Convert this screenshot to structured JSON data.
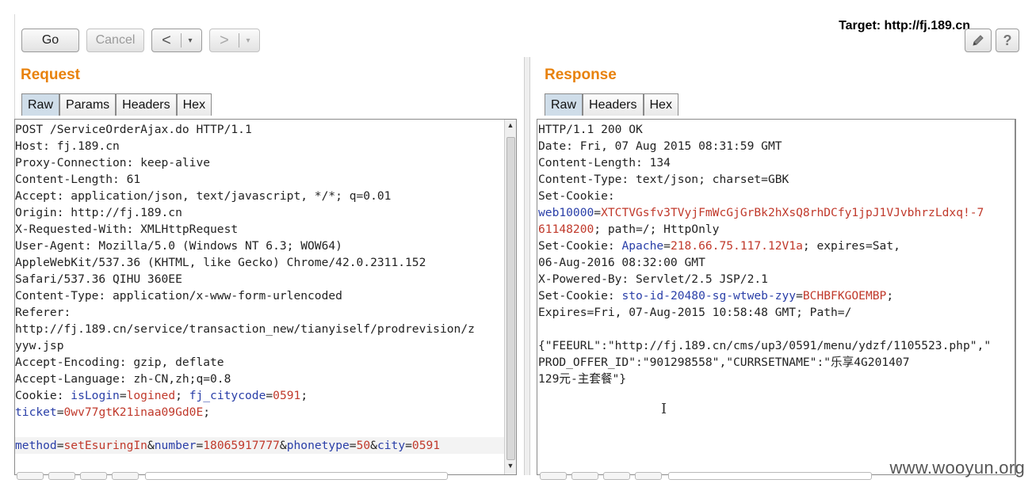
{
  "toolbar": {
    "go_label": "Go",
    "cancel_label": "Cancel",
    "back_symbol": "<",
    "forward_symbol": ">",
    "dropdown_symbol": "▾",
    "target_label": "Target: http://fj.189.cn",
    "edit_icon": "pencil-icon",
    "help_label": "?"
  },
  "request": {
    "title": "Request",
    "tabs": [
      "Raw",
      "Params",
      "Headers",
      "Hex"
    ],
    "active_tab": "Raw",
    "lines": [
      [
        {
          "t": "POST /ServiceOrderAjax.do HTTP/1.1"
        }
      ],
      [
        {
          "t": "Host: fj.189.cn"
        }
      ],
      [
        {
          "t": "Proxy-Connection: keep-alive"
        }
      ],
      [
        {
          "t": "Content-Length: 61"
        }
      ],
      [
        {
          "t": "Accept: application/json, text/javascript, */*; q=0.01"
        }
      ],
      [
        {
          "t": "Origin: http://fj.189.cn"
        }
      ],
      [
        {
          "t": "X-Requested-With: XMLHttpRequest"
        }
      ],
      [
        {
          "t": "User-Agent: Mozilla/5.0 (Windows NT 6.3; WOW64)"
        }
      ],
      [
        {
          "t": "AppleWebKit/537.36 (KHTML, like Gecko) Chrome/42.0.2311.152"
        }
      ],
      [
        {
          "t": "Safari/537.36 QIHU 360EE"
        }
      ],
      [
        {
          "t": "Content-Type: application/x-www-form-urlencoded"
        }
      ],
      [
        {
          "t": "Referer:"
        }
      ],
      [
        {
          "t": "http://fj.189.cn/service/transaction_new/tianyiself/prodrevision/z"
        }
      ],
      [
        {
          "t": "yyw.jsp"
        }
      ],
      [
        {
          "t": "Accept-Encoding: gzip, deflate"
        }
      ],
      [
        {
          "t": "Accept-Language: zh-CN,zh;q=0.8"
        }
      ],
      [
        {
          "t": "Cookie: "
        },
        {
          "t": "isLogin",
          "c": "k"
        },
        {
          "t": "="
        },
        {
          "t": "logined",
          "c": "v"
        },
        {
          "t": "; "
        },
        {
          "t": "fj_citycode",
          "c": "k"
        },
        {
          "t": "="
        },
        {
          "t": "0591",
          "c": "v"
        },
        {
          "t": ";"
        }
      ],
      [
        {
          "t": "ticket",
          "c": "k"
        },
        {
          "t": "="
        },
        {
          "t": "0wv77gtK21inaa09Gd0E",
          "c": "v"
        },
        {
          "t": ";"
        }
      ],
      [
        {
          "t": ""
        }
      ],
      [
        {
          "t": "method",
          "c": "k"
        },
        {
          "t": "="
        },
        {
          "t": "setEsuringIn",
          "c": "v"
        },
        {
          "t": "&"
        },
        {
          "t": "number",
          "c": "k"
        },
        {
          "t": "="
        },
        {
          "t": "18065917777",
          "c": "v"
        },
        {
          "t": "&"
        },
        {
          "t": "phonetype",
          "c": "k"
        },
        {
          "t": "="
        },
        {
          "t": "50",
          "c": "v"
        },
        {
          "t": "&"
        },
        {
          "t": "city",
          "c": "k"
        },
        {
          "t": "="
        },
        {
          "t": "0591",
          "c": "v"
        }
      ]
    ]
  },
  "response": {
    "title": "Response",
    "tabs": [
      "Raw",
      "Headers",
      "Hex"
    ],
    "active_tab": "Raw",
    "lines": [
      [
        {
          "t": "HTTP/1.1 200 OK"
        }
      ],
      [
        {
          "t": "Date: Fri, 07 Aug 2015 08:31:59 GMT"
        }
      ],
      [
        {
          "t": "Content-Length: 134"
        }
      ],
      [
        {
          "t": "Content-Type: text/json; charset=GBK"
        }
      ],
      [
        {
          "t": "Set-Cookie:"
        }
      ],
      [
        {
          "t": "web10000",
          "c": "k"
        },
        {
          "t": "="
        },
        {
          "t": "XTCTVGsfv3TVyjFmWcGjGrBk2hXsQ8rhDCfy1jpJ1VJvbhrzLdxq!-7",
          "c": "v"
        }
      ],
      [
        {
          "t": "61148200",
          "c": "v"
        },
        {
          "t": "; path=/; HttpOnly"
        }
      ],
      [
        {
          "t": "Set-Cookie: "
        },
        {
          "t": "Apache",
          "c": "k"
        },
        {
          "t": "="
        },
        {
          "t": "218.66.75.117.12V1a",
          "c": "v"
        },
        {
          "t": "; expires=Sat,"
        }
      ],
      [
        {
          "t": "06-Aug-2016 08:32:00 GMT"
        }
      ],
      [
        {
          "t": "X-Powered-By: Servlet/2.5 JSP/2.1"
        }
      ],
      [
        {
          "t": "Set-Cookie: "
        },
        {
          "t": "sto-id-20480-sg-wtweb-zyy",
          "c": "k"
        },
        {
          "t": "="
        },
        {
          "t": "BCHBFKGOEMBP",
          "c": "v"
        },
        {
          "t": ";"
        }
      ],
      [
        {
          "t": "Expires=Fri, 07-Aug-2015 10:58:48 GMT; Path=/"
        }
      ],
      [
        {
          "t": ""
        }
      ],
      [
        {
          "t": "{\"FEEURL\":\"http://fj.189.cn/cms/up3/0591/menu/ydzf/1105523.php\",\""
        }
      ],
      [
        {
          "t": "PROD_OFFER_ID\":\"901298558\",\"CURRSETNAME\":\"乐享4G201407"
        }
      ],
      [
        {
          "t": "129元-主套餐\"}"
        }
      ]
    ]
  },
  "watermark": "www.wooyun.org",
  "colors": {
    "title": "#e8820c",
    "cookie_name": "#2a3fa8",
    "cookie_value": "#c0392b",
    "active_tab": "#cfdde9"
  }
}
